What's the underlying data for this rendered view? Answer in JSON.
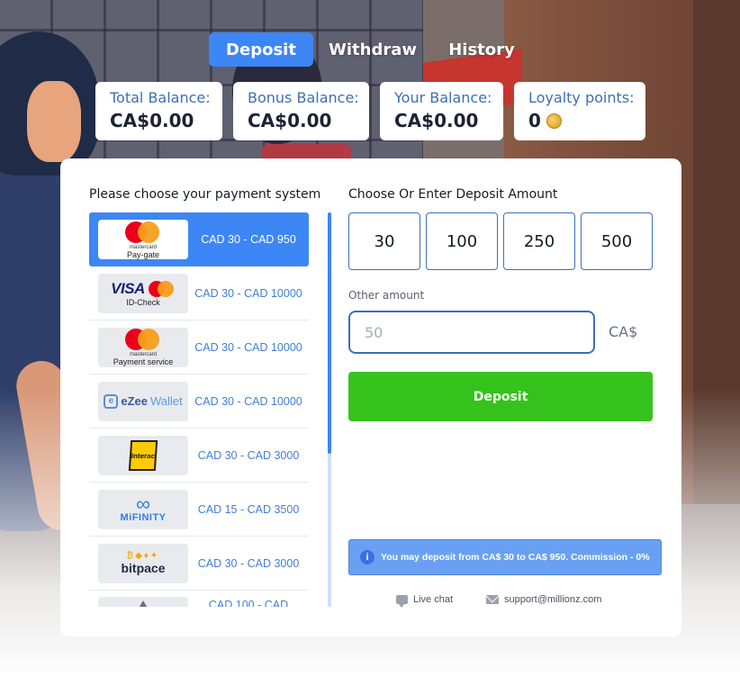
{
  "tabs": [
    {
      "label": "Deposit",
      "active": true
    },
    {
      "label": "Withdraw",
      "active": false
    },
    {
      "label": "History",
      "active": false
    }
  ],
  "balances": [
    {
      "label": "Total Balance:",
      "value": "CA$0.00"
    },
    {
      "label": "Bonus Balance:",
      "value": "CA$0.00"
    },
    {
      "label": "Your Balance:",
      "value": "CA$0.00"
    },
    {
      "label": "Loyalty points:",
      "value": "0",
      "icon": "coin-icon"
    }
  ],
  "payment": {
    "heading": "Please choose your payment system",
    "methods": [
      {
        "logo": "mastercard-logo",
        "logo_text": "mastercard",
        "logo_caption": "Pay-gate",
        "range": "CAD 30 - CAD 950",
        "selected": true
      },
      {
        "logo": "visa-mastercard-logo",
        "logo_text": "VISA",
        "logo_caption": "ID-Check",
        "range": "CAD 30 - CAD 10000",
        "selected": false
      },
      {
        "logo": "mastercard-logo",
        "logo_text": "mastercard",
        "logo_caption": "Payment service",
        "range": "CAD 30 - CAD 10000",
        "selected": false
      },
      {
        "logo": "ezeewallet-logo",
        "logo_text": "eZee",
        "logo_caption": "Wallet",
        "range": "CAD 30 - CAD 10000",
        "selected": false
      },
      {
        "logo": "interac-logo",
        "logo_text": "Interac",
        "range": "CAD 30 - CAD 3000",
        "selected": false
      },
      {
        "logo": "mifinity-logo",
        "logo_text": "MiFINITY",
        "range": "CAD 15 - CAD 3500",
        "selected": false
      },
      {
        "logo": "bitpace-logo",
        "logo_text": "bitpace",
        "range": "CAD 30 - CAD 3000",
        "selected": false
      },
      {
        "logo": "crypto-logo",
        "range": "CAD 100 - CAD",
        "selected": false
      }
    ]
  },
  "deposit": {
    "heading": "Choose Or Enter Deposit Amount",
    "amounts": [
      "30",
      "100",
      "250",
      "500"
    ],
    "other_label": "Other amount",
    "other_placeholder": "50",
    "currency": "CA$",
    "button_label": "Deposit",
    "info_text": "You may deposit from CA$ 30 to CA$ 950. Commission - 0%",
    "live_chat": "Live chat",
    "support_email": "support@millionz.com"
  },
  "colors": {
    "accent": "#3d86f5",
    "deposit_button": "#36c21c",
    "info_bg": "#6aa0f3",
    "label_blue": "#3d6fb6"
  }
}
